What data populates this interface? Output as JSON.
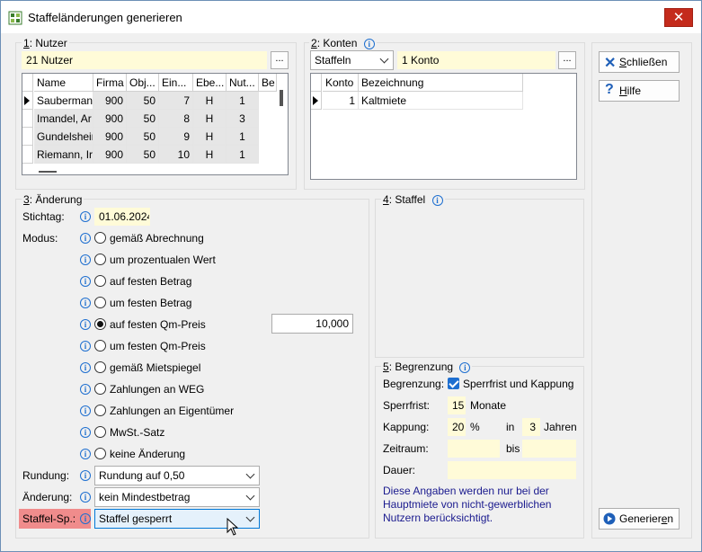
{
  "window": {
    "title": "Staffeländerungen generieren",
    "close_glyph": "✕"
  },
  "nutzer": {
    "title_num": "1",
    "title_rest": ": Nutzer",
    "summary": "21 Nutzer",
    "dots": "...",
    "columns": [
      "Name",
      "Firma",
      "Obj...",
      "Ein...",
      "Ebe...",
      "Nut...",
      "Be"
    ],
    "rows": [
      [
        "Sauberman",
        "900",
        "50",
        "7",
        "H",
        "1"
      ],
      [
        "Imandel, Ar",
        "900",
        "50",
        "8",
        "H",
        "3"
      ],
      [
        "Gundelsheir",
        "900",
        "50",
        "9",
        "H",
        "1"
      ],
      [
        "Riemann, Ir",
        "900",
        "50",
        "10",
        "H",
        "1"
      ]
    ]
  },
  "konten": {
    "title_num": "2",
    "title_rest": ": Konten",
    "mode": "Staffeln",
    "summary": "1 Konto",
    "dots": "...",
    "columns": [
      "Konto",
      "Bezeichnung"
    ],
    "rows": [
      [
        "1",
        "Kaltmiete"
      ]
    ]
  },
  "aenderung": {
    "title_num": "3",
    "title_rest": ": Änderung",
    "stichtag_label": "Stichtag:",
    "stichtag_value": "01.06.2024",
    "modus_label": "Modus:",
    "modes": [
      "gemäß Abrechnung",
      "um prozentualen Wert",
      "auf festen Betrag",
      "um festen Betrag",
      "auf festen Qm-Preis",
      "um festen Qm-Preis",
      "gemäß Mietspiegel",
      "Zahlungen an WEG",
      "Zahlungen an Eigentümer",
      "MwSt.-Satz",
      "keine Änderung"
    ],
    "selected_mode": "auf festen Qm-Preis",
    "qm_value": "10,000",
    "rundung_label": "Rundung:",
    "rundung_value": "Rundung auf 0,50",
    "aenderung_label": "Änderung:",
    "aenderung_value": "kein Mindestbetrag",
    "staffelsp_label": "Staffel-Sp.:",
    "staffelsp_value": "Staffel gesperrt"
  },
  "staffel": {
    "title_num": "4",
    "title_rest": ": Staffel"
  },
  "begrenzung": {
    "title_num": "5",
    "title_rest": ": Begrenzung",
    "begrenzung_label": "Begrenzung:",
    "checkbox_label": "Sperrfrist und Kappung",
    "sperrfrist_label": "Sperrfrist:",
    "sperrfrist_value": "15",
    "sperrfrist_unit": "Monate",
    "kappung_label": "Kappung:",
    "kappung_value": "20",
    "kappung_unit": "%",
    "in_label": "in",
    "jahre_value": "3",
    "jahre_unit": "Jahren",
    "zeitraum_label": "Zeitraum:",
    "bis_label": "bis",
    "dauer_label": "Dauer:",
    "note": "Diese Angaben werden nur bei der Hauptmiete von nicht-gewerblichen Nutzern berücksichtigt."
  },
  "buttons": {
    "close_u": "S",
    "close_rest": "chließen",
    "help_u": "H",
    "help_rest": "ilfe",
    "generate_pre": "Generier",
    "generate_u": "e",
    "generate_post": "n"
  },
  "colors": {
    "accent": "#1e6fd0",
    "input_bg": "#fffbd8",
    "highlight_label": "#f08c8c",
    "close_red": "#c42b1c"
  }
}
